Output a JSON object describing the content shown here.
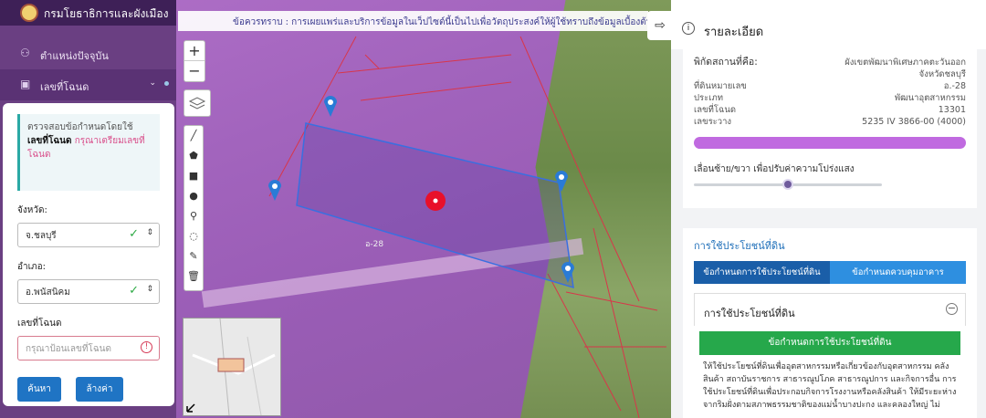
{
  "app": {
    "title": "กรมโยธาธิการและผังเมือง"
  },
  "sidebar": {
    "items": [
      {
        "label": "ตำแหน่งปัจจุบัน"
      },
      {
        "label": "เลขที่โฉนด"
      }
    ]
  },
  "search_panel": {
    "hint_prefix": "ตรวจสอบข้อกำหนดโดยใช้",
    "hint_bold": "เลขที่โฉนด",
    "hint_pink": "กรุณาเตรียมเลขที่",
    "hint_suffix": "โฉนด",
    "province_label": "จังหวัด:",
    "province_value": "จ.ชลบุรี",
    "district_label": "อำเภอ:",
    "district_value": "อ.พนัสนิคม",
    "deed_label": "เลขที่โฉนด",
    "deed_placeholder": "กรุณาป้อนเลขที่โฉนด",
    "search_button": "ค้นหา",
    "clear_button": "ล้างค่า"
  },
  "map": {
    "notice": "ข้อควรทราบ : การเผยแพร่และบริการข้อมูลในเว็ปไซต์นี้เป็นไปเพื่อวัตถุประสงค์ให้ผู้ใช้ทราบถึงข้อมูลเบื้องต้นได้เท่านั้น",
    "zoom_in": "+",
    "zoom_out": "−",
    "parcel_label": "อ-28"
  },
  "details": {
    "title": "รายละเอียด",
    "location_label": "พิกัดสถานที่คือ:",
    "location_value": "ผังเขตพัฒนาพิเศษภาคตะวันออก",
    "location_value2": "จังหวัดชลบุรี",
    "rows": [
      {
        "key": "ที่ดินหมายเลข",
        "value": "อ.-28"
      },
      {
        "key": "ประเภท",
        "value": "พัฒนาอุตสาหกรรม"
      },
      {
        "key": "เลขที่โฉนด",
        "value": "13301"
      },
      {
        "key": "เลขระวาง",
        "value": "5235 IV 3866-00 (4000)"
      }
    ],
    "legend_color": "#c06ae0",
    "slider_label": "เลื่อนซ้าย/ขวา เพื่อปรับค่าความโปร่งแสง",
    "opacity": 0.5
  },
  "landuse": {
    "section_title": "การใช้ประโยชน์ที่ดิน",
    "tabs": [
      "ข้อกำหนดการใช้ประโยชน์ที่ดิน",
      "ข้อกำหนดควบคุมอาคาร"
    ],
    "accordion_title": "การใช้ประโยชน์ที่ดิน",
    "green_bar": "ข้อกำหนดการใช้ประโยชน์ที่ดิน",
    "description": "ให้ใช้ประโยชน์ที่ดินเพื่ออุตสาหกรรมหรือเกี่ยวข้องกับอุตสาหกรรม คลังสินค้า สถาบันราชการ สาธารณูปโภค สาธารณูปการ และกิจการอื่น การใช้ประโยชน์ที่ดินเพื่อประกอบกิจการโรงงานหรือคลังสินค้า ให้มีระยะห่างจากริมฝั่งตามสภาพธรรมชาติของแม่น้ำบางปะกง และคลองใหญ่ ไม่"
  }
}
